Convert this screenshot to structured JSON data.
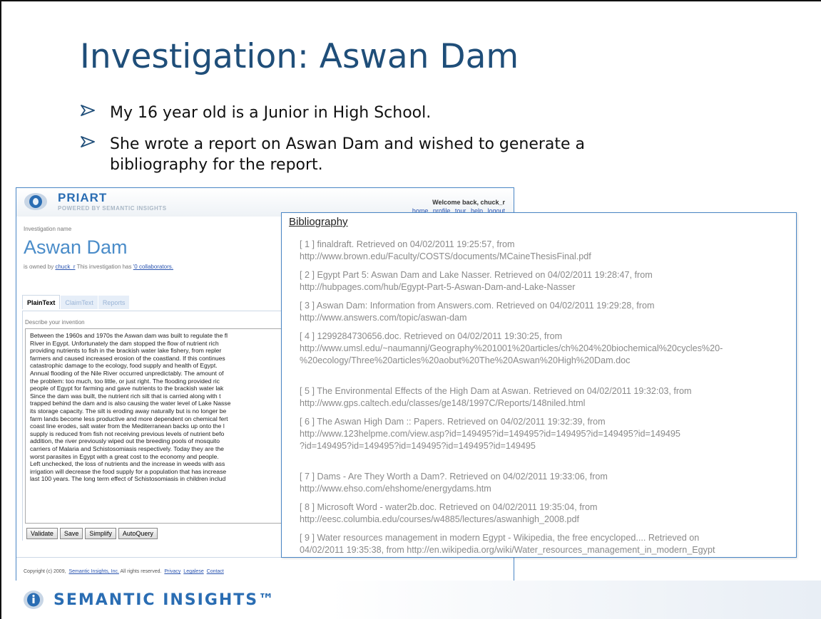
{
  "slide": {
    "title": "Investigation: Aswan Dam",
    "bullets": [
      "My 16 year old is a Junior in High School.",
      "She wrote a report on Aswan Dam and wished to generate a bibliography for the report."
    ],
    "banner_text": "SEMANTIC INSIGHTS™"
  },
  "app": {
    "brand": "PRIART",
    "subtitle": "POWERED BY SEMANTIC INSIGHTS",
    "welcome": "Welcome back, chuck_r",
    "links": [
      "home",
      "profile",
      "tour",
      "help",
      "logout"
    ],
    "investigation_label": "Investigation name",
    "investigation_name": "Aswan Dam",
    "owned_prefix": "is owned by",
    "owner": "chuck_r",
    "owned_middle": "This investigation has",
    "collaborators": "'0 collaborators.",
    "tabs": [
      "PlainText",
      "ClaimText",
      "Reports"
    ],
    "describe_label": "Describe your invention",
    "text_lines": [
      "Between the 1960s and 1970s the Aswan dam was built to regulate the fl",
      "River in Egypt. Unfortunately the dam stopped the flow of nutrient rich",
      "providing nutrients to fish in the brackish water lake fishery, from repler",
      "farmers and caused increased erosion of the coastland. If this continues",
      "catastrophic damage to the ecology, food supply and health of Egypt.",
      "Annual flooding of the Nile River occurred unpredictably. The amount of",
      "the problem: too much, too little, or just right. The flooding provided ric",
      "people of Egypt for farming and gave nutrients to the brackish water lak",
      "Since the dam was built, the nutrient rich silt that is carried along with t",
      "trapped behind the dam and is also causing the water level of Lake Nasse",
      "its storage capacity. The silt is eroding away naturally but is no longer be",
      "farm lands become less productive and more dependent on chemical fert",
      "coast line erodes, salt water from the Mediterranean backs up onto the l",
      "supply is reduced from fish not receiving previous levels of nutrient befo",
      "addition, the river previously wiped out the breeding pools of mosquito",
      "carriers of Malaria and Schistosomiasis respectively. Today they are the",
      "worst parasites in Egypt with a great cost to the economy and people.",
      "Left unchecked, the loss of nutrients and the increase in weeds with ass",
      "irrigation will decrease the food supply for a population that has increase",
      "last 100 years. The long term effect of Schistosomiasis in children includ"
    ],
    "buttons": [
      "Validate",
      "Save",
      "Simplify",
      "AutoQuery"
    ],
    "footer_prefix": "Copyright (c) 2009,",
    "footer_company": "Semantic Insights, Inc.",
    "footer_rights": "All rights reserved.",
    "footer_links": [
      "Privacy",
      "Legalese",
      "Contact"
    ]
  },
  "bibliography": {
    "title": "Bibliography",
    "entries": [
      "[ 1 ] finaldraft. Retrieved on 04/02/2011 19:25:57, from\nhttp://www.brown.edu/Faculty/COSTS/documents/MCaineThesisFinal.pdf",
      "[ 2 ] Egypt Part 5:  Aswan Dam and Lake Nasser. Retrieved on 04/02/2011 19:28:47, from\nhttp://hubpages.com/hub/Egypt-Part-5-Aswan-Dam-and-Lake-Nasser",
      "[ 3 ] Aswan Dam: Information from Answers.com. Retrieved on 04/02/2011 19:29:28, from\nhttp://www.answers.com/topic/aswan-dam",
      "[ 4 ] 1299284730656.doc. Retrieved on 04/02/2011 19:30:25, from\nhttp://www.umsl.edu/~naumannj/Geography%201001%20articles/ch%204%20biochemical%20cycles%20-\n%20ecology/Three%20articles%20aobut%20The%20Aswan%20High%20Dam.doc",
      "[ 5 ] The Environmental Effects of the High Dam at Aswan. Retrieved on 04/02/2011 19:32:03, from\nhttp://www.gps.caltech.edu/classes/ge148/1997C/Reports/148niled.html",
      "[ 6 ] The Aswan High Dam  :: Papers. Retrieved on 04/02/2011 19:32:39, from\nhttp://www.123helpme.com/view.asp?id=149495?id=149495?id=149495?id=149495?id=149495\n?id=149495?id=149495?id=149495?id=149495?id=149495",
      "[ 7 ] Dams - Are They Worth a Dam?. Retrieved on 04/02/2011 19:33:06, from\nhttp://www.ehso.com/ehshome/energydams.htm",
      "[ 8 ] Microsoft Word - water2b.doc. Retrieved on 04/02/2011 19:35:04, from\nhttp://eesc.columbia.edu/courses/w4885/lectures/aswanhigh_2008.pdf",
      "[ 9 ] Water resources management in modern Egypt - Wikipedia, the free encycloped.... Retrieved on\n04/02/2011 19:35:38, from  http://en.wikipedia.org/wiki/Water_resources_management_in_modern_Egypt"
    ]
  }
}
